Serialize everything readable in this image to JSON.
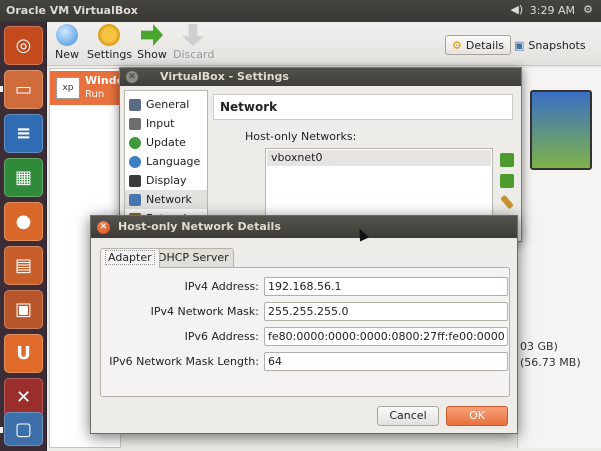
{
  "topbar": {
    "title": "Oracle VM VirtualBox",
    "volume_icon": "speaker-icon",
    "time": "3:29 AM",
    "gear_icon": "gear-icon"
  },
  "launcher": {
    "items": [
      "ubuntu-dash",
      "files",
      "writer",
      "calc",
      "firefox",
      "impress",
      "software-center",
      "ubuntu-one",
      "settings",
      "virtualbox"
    ]
  },
  "toolbar": {
    "new": "New",
    "settings": "Settings",
    "show": "Show",
    "discard": "Discard",
    "details": "Details",
    "snapshots": "Snapshots"
  },
  "vmlist": {
    "name": "Windo",
    "state": "Run",
    "os_badge": "xp"
  },
  "details_pane": {
    "line1": "03 GB)",
    "line2": "(56.73 MB)"
  },
  "settings": {
    "title": "VirtualBox - Settings",
    "categories": [
      "General",
      "Input",
      "Update",
      "Language",
      "Display",
      "Network",
      "Extensions"
    ],
    "selected": "Network",
    "header": "Network",
    "hon_label": "Host-only Networks:",
    "networks": [
      "vboxnet0"
    ]
  },
  "details": {
    "title": "Host-only Network Details",
    "tabs": [
      "Adapter",
      "DHCP Server"
    ],
    "fields": {
      "ipv4_address_label": "IPv4 Address:",
      "ipv4_address": "192.168.56.1",
      "ipv4_mask_label": "IPv4 Network Mask:",
      "ipv4_mask": "255.255.255.0",
      "ipv6_address_label": "IPv6 Address:",
      "ipv6_address": "fe80:0000:0000:0000:0800:27ff:fe00:0000",
      "ipv6_mask_len_label": "IPv6 Network Mask Length:",
      "ipv6_mask_len": "64"
    },
    "cancel": "Cancel",
    "ok": "OK"
  }
}
